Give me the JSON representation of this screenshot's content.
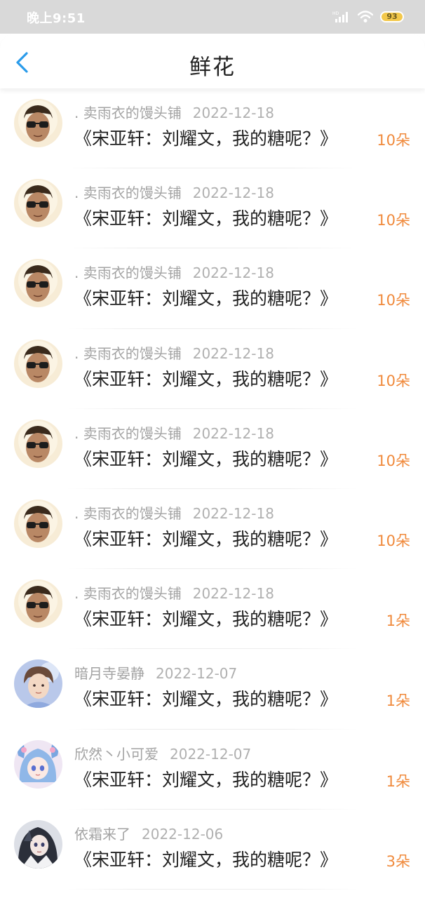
{
  "status_bar": {
    "time": "晚上9:51",
    "battery": "93"
  },
  "header": {
    "title": "鲜花",
    "back_icon": "chevron-left-icon",
    "accent_color": "#2a9bea"
  },
  "flower_color": "#f08a3c",
  "items": [
    {
      "user": ". 卖雨衣的馒头铺",
      "date": "2022-12-18",
      "title": "《宋亚轩：刘耀文，我的糖呢？》",
      "count": "10朵",
      "avatar": "sunglasses-avatar"
    },
    {
      "user": ". 卖雨衣的馒头铺",
      "date": "2022-12-18",
      "title": "《宋亚轩：刘耀文，我的糖呢？》",
      "count": "10朵",
      "avatar": "sunglasses-avatar"
    },
    {
      "user": ". 卖雨衣的馒头铺",
      "date": "2022-12-18",
      "title": "《宋亚轩：刘耀文，我的糖呢？》",
      "count": "10朵",
      "avatar": "sunglasses-avatar"
    },
    {
      "user": ". 卖雨衣的馒头铺",
      "date": "2022-12-18",
      "title": "《宋亚轩：刘耀文，我的糖呢？》",
      "count": "10朵",
      "avatar": "sunglasses-avatar"
    },
    {
      "user": ". 卖雨衣的馒头铺",
      "date": "2022-12-18",
      "title": "《宋亚轩：刘耀文，我的糖呢？》",
      "count": "10朵",
      "avatar": "sunglasses-avatar"
    },
    {
      "user": ". 卖雨衣的馒头铺",
      "date": "2022-12-18",
      "title": "《宋亚轩：刘耀文，我的糖呢？》",
      "count": "10朵",
      "avatar": "sunglasses-avatar"
    },
    {
      "user": ". 卖雨衣的馒头铺",
      "date": "2022-12-18",
      "title": "《宋亚轩：刘耀文，我的糖呢？》",
      "count": "1朵",
      "avatar": "sunglasses-avatar"
    },
    {
      "user": "暗月寺晏静",
      "date": "2022-12-07",
      "title": "《宋亚轩：刘耀文，我的糖呢？》",
      "count": "1朵",
      "avatar": "boy-avatar"
    },
    {
      "user": "欣然丶小可爱",
      "date": "2022-12-07",
      "title": "《宋亚轩：刘耀文，我的糖呢？》",
      "count": "1朵",
      "avatar": "anime-girl-avatar"
    },
    {
      "user": "依霜来了",
      "date": "2022-12-06",
      "title": "《宋亚轩：刘耀文，我的糖呢？》",
      "count": "3朵",
      "avatar": "dark-anime-avatar"
    }
  ]
}
